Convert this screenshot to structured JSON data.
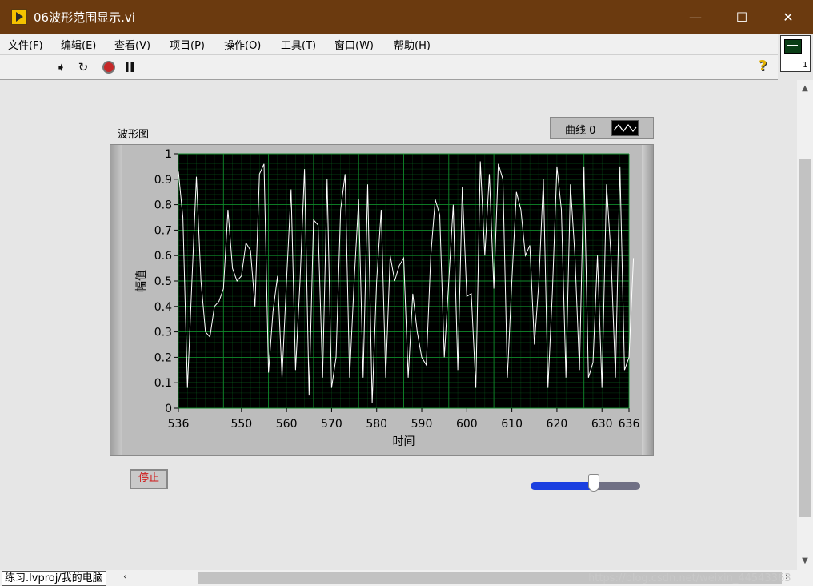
{
  "window": {
    "title": "06波形范围显示.vi",
    "controls": {
      "minimize": "—",
      "maximize": "☐",
      "close": "✕"
    }
  },
  "menu": [
    "文件(F)",
    "编辑(E)",
    "查看(V)",
    "项目(P)",
    "操作(O)",
    "工具(T)",
    "窗口(W)",
    "帮助(H)"
  ],
  "vi_icon": {
    "number": "1"
  },
  "toolbar": {
    "run": "➧",
    "run_continuous": "↻",
    "help": "?"
  },
  "graph": {
    "label": "波形图",
    "legend_name": "曲线 0",
    "plot_color": "#ffffff",
    "background_color": "#000000",
    "grid_color": "#0f8a2a"
  },
  "chart_data": {
    "type": "line",
    "xlabel": "时间",
    "ylabel": "幅值",
    "xlim": [
      536,
      636
    ],
    "ylim": [
      0,
      1
    ],
    "x_ticks": [
      "536",
      "550",
      "560",
      "570",
      "580",
      "590",
      "600",
      "610",
      "620",
      "630",
      "636"
    ],
    "y_ticks": [
      "0",
      "0.1",
      "0.2",
      "0.3",
      "0.4",
      "0.5",
      "0.6",
      "0.7",
      "0.8",
      "0.9",
      "1"
    ],
    "grid": true,
    "series": [
      {
        "x_start": 536,
        "dx": 1,
        "values": [
          0.93,
          0.75,
          0.08,
          0.5,
          0.91,
          0.5,
          0.3,
          0.28,
          0.4,
          0.42,
          0.47,
          0.78,
          0.55,
          0.5,
          0.52,
          0.65,
          0.62,
          0.4,
          0.92,
          0.96,
          0.14,
          0.38,
          0.52,
          0.12,
          0.5,
          0.86,
          0.15,
          0.5,
          0.94,
          0.05,
          0.74,
          0.72,
          0.12,
          0.9,
          0.08,
          0.2,
          0.78,
          0.92,
          0.12,
          0.5,
          0.82,
          0.12,
          0.88,
          0.02,
          0.5,
          0.78,
          0.12,
          0.6,
          0.5,
          0.56,
          0.59,
          0.12,
          0.45,
          0.3,
          0.2,
          0.17,
          0.6,
          0.82,
          0.76,
          0.2,
          0.5,
          0.8,
          0.15,
          0.87,
          0.44,
          0.45,
          0.08,
          0.97,
          0.6,
          0.92,
          0.47,
          0.96,
          0.9,
          0.12,
          0.5,
          0.85,
          0.78,
          0.6,
          0.64,
          0.25,
          0.5,
          0.9,
          0.08,
          0.46,
          0.95,
          0.78,
          0.12,
          0.88,
          0.6,
          0.15,
          0.95,
          0.12,
          0.18,
          0.6,
          0.08,
          0.88,
          0.6,
          0.12,
          0.95,
          0.15,
          0.2,
          0.59
        ]
      }
    ]
  },
  "stop_button": {
    "label": "停止"
  },
  "slider": {
    "value": 0.58
  },
  "status": {
    "context": "练习.lvproj/我的电脑",
    "watermark": "https://blog.csdn.net/weixin_44543363"
  }
}
